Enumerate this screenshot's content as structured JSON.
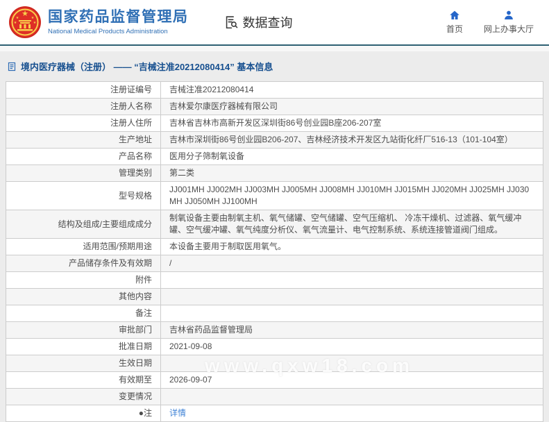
{
  "header": {
    "agency_name_cn": "国家药品监督管理局",
    "agency_name_en": "National Medical Products Administration",
    "emblem_icon": "china-national-emblem",
    "section": {
      "icon": "document-search-icon",
      "label": "数据查询"
    },
    "nav": [
      {
        "icon": "home-icon",
        "label": "首页"
      },
      {
        "icon": "user-icon",
        "label": "网上办事大厅"
      }
    ]
  },
  "breadcrumb": {
    "icon": "document-icon",
    "text": "境内医疗器械（注册） —— “吉械注准20212080414” 基本信息"
  },
  "table": {
    "rows": [
      {
        "label": "注册证编号",
        "value": "吉械注准20212080414"
      },
      {
        "label": "注册人名称",
        "value": "吉林爱尔康医疗器械有限公司"
      },
      {
        "label": "注册人住所",
        "value": "吉林省吉林市高新开发区深圳街86号创业园B座206-207室"
      },
      {
        "label": "生产地址",
        "value": "吉林市深圳街86号创业园B206-207、吉林经济技术开发区九站街化纤厂516-13（101-104室）"
      },
      {
        "label": "产品名称",
        "value": "医用分子筛制氧设备"
      },
      {
        "label": "管理类别",
        "value": "第二类"
      },
      {
        "label": "型号规格",
        "value": "JJ001MH JJ002MH JJ003MH JJ005MH JJ008MH JJ010MH JJ015MH JJ020MH JJ025MH JJ030MH JJ050MH JJ100MH"
      },
      {
        "label": "结构及组成/主要组成成分",
        "value": "制氧设备主要由制氧主机、氧气储罐、空气储罐、空气压缩机、 冷冻干燥机、过滤器、氧气缓冲罐、空气缓冲罐、氧气纯度分析仪、氧气流量计、电气控制系统、系统连接管道阀门组成。"
      },
      {
        "label": "适用范围/预期用途",
        "value": "本设备主要用于制取医用氧气。"
      },
      {
        "label": "产品储存条件及有效期",
        "value": "/"
      },
      {
        "label": "附件",
        "value": ""
      },
      {
        "label": "其他内容",
        "value": ""
      },
      {
        "label": "备注",
        "value": ""
      },
      {
        "label": "审批部门",
        "value": "吉林省药品监督管理局"
      },
      {
        "label": "批准日期",
        "value": "2021-09-08"
      },
      {
        "label": "生效日期",
        "value": ""
      },
      {
        "label": "有效期至",
        "value": "2026-09-07"
      },
      {
        "label": "变更情况",
        "value": ""
      },
      {
        "label": "●注",
        "value": "详情",
        "link": true
      }
    ]
  },
  "watermark": "www.qxw18.com",
  "colors": {
    "brand_blue": "#3070b5",
    "nav_blue": "#2566c9",
    "divider_blue": "#2d6073",
    "breadcrumb_blue": "#164f8f",
    "link_blue": "#4083d6",
    "emblem_red": "#de2f26",
    "emblem_gold": "#f9d04b",
    "row_alt_bg": "#f5f5f5",
    "table_border": "#cccccc"
  }
}
